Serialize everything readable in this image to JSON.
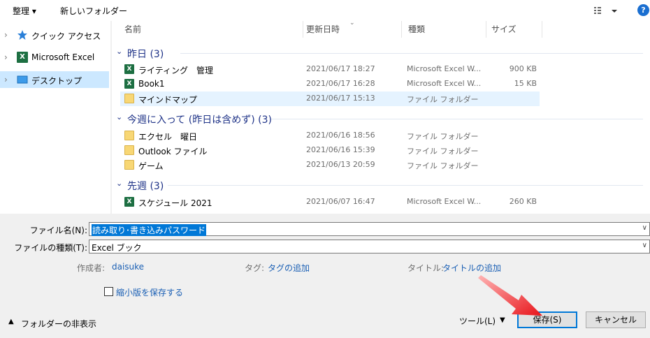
{
  "toolbar": {
    "organize_label": "整理 ▾",
    "new_folder_label": "新しいフォルダー",
    "help_label": "?"
  },
  "nav": {
    "items": [
      {
        "label": "クイック アクセス",
        "icon": "star-icon"
      },
      {
        "label": "Microsoft Excel",
        "icon": "excel-icon"
      },
      {
        "label": "デスクトップ",
        "icon": "desktop-icon"
      }
    ]
  },
  "columns": {
    "name": "名前",
    "modified": "更新日時",
    "type": "種類",
    "size": "サイズ"
  },
  "groups": [
    {
      "label": "昨日 (3)",
      "rows": [
        {
          "name": "ライティング　管理",
          "date": "2021/06/17 18:27",
          "type": "Microsoft Excel W...",
          "size": "900 KB",
          "icon": "excel-file-icon"
        },
        {
          "name": "Book1",
          "date": "2021/06/17 16:28",
          "type": "Microsoft Excel W...",
          "size": "15 KB",
          "icon": "excel-file-icon"
        },
        {
          "name": "マインドマップ",
          "date": "2021/06/17 15:13",
          "type": "ファイル フォルダー",
          "size": "",
          "icon": "folder-icon"
        }
      ]
    },
    {
      "label": "今週に入って (昨日は含めず) (3)",
      "rows": [
        {
          "name": "エクセル　曜日",
          "date": "2021/06/16 18:56",
          "type": "ファイル フォルダー",
          "size": "",
          "icon": "folder-icon"
        },
        {
          "name": "Outlook ファイル",
          "date": "2021/06/16 15:39",
          "type": "ファイル フォルダー",
          "size": "",
          "icon": "folder-icon"
        },
        {
          "name": "ゲーム",
          "date": "2021/06/13 20:59",
          "type": "ファイル フォルダー",
          "size": "",
          "icon": "folder-icon"
        }
      ]
    },
    {
      "label": "先週 (3)",
      "rows": [
        {
          "name": "スケジュール 2021",
          "date": "2021/06/07 16:47",
          "type": "Microsoft Excel W...",
          "size": "260 KB",
          "icon": "excel-file-icon"
        }
      ]
    }
  ],
  "form": {
    "filename_label": "ファイル名(N):",
    "filename_value": "読み取り･書き込みパスワード",
    "filetype_label": "ファイルの種類(T):",
    "filetype_value": "Excel ブック",
    "author_label": "作成者:",
    "author_value": "daisuke",
    "tags_label": "タグ:",
    "tags_value": "タグの追加",
    "title_label": "タイトル:",
    "title_value": "タイトルの追加",
    "thumbnail_label": "縮小版を保存する"
  },
  "footer": {
    "hide_folders_label": "フォルダーの非表示",
    "tools_label": "ツール(L)",
    "save_label": "保存(S)",
    "cancel_label": "キャンセル"
  },
  "colors": {
    "accent": "#0078d7",
    "group_header": "#1e3287",
    "link": "#1a5fb4",
    "selection": "#cce8ff",
    "annotation_arrow": "#e8141a"
  }
}
